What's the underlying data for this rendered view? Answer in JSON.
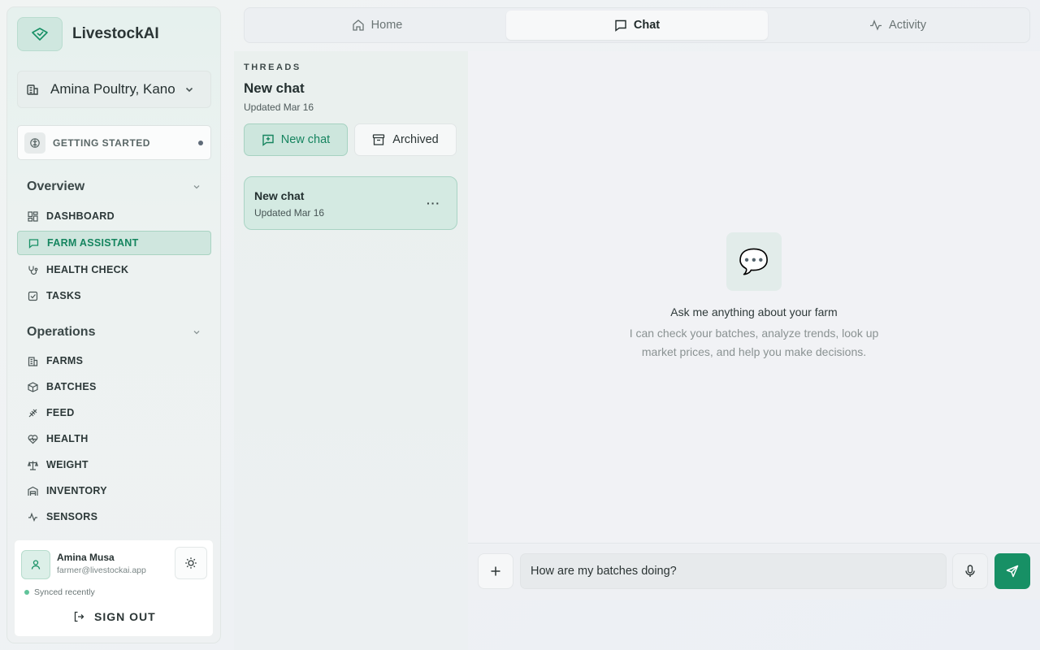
{
  "brand": {
    "name": "LivestockAI",
    "logo_icon": "leaf-icon"
  },
  "farm_selector": {
    "value": "Amina Poultry, Kano"
  },
  "getting_started": {
    "label": "GETTING STARTED"
  },
  "nav": {
    "overview": {
      "title": "Overview",
      "items": [
        {
          "label": "DASHBOARD",
          "icon": "dashboard-icon"
        },
        {
          "label": "FARM ASSISTANT",
          "icon": "chat-icon",
          "active": true
        },
        {
          "label": "HEALTH CHECK",
          "icon": "stethoscope-icon"
        },
        {
          "label": "TASKS",
          "icon": "checkbox-icon"
        }
      ]
    },
    "operations": {
      "title": "Operations",
      "items": [
        {
          "label": "FARMS",
          "icon": "building-icon"
        },
        {
          "label": "BATCHES",
          "icon": "box-icon"
        },
        {
          "label": "FEED",
          "icon": "wheat-icon"
        },
        {
          "label": "HEALTH",
          "icon": "heart-pulse-icon"
        },
        {
          "label": "WEIGHT",
          "icon": "scale-icon"
        },
        {
          "label": "INVENTORY",
          "icon": "warehouse-icon"
        },
        {
          "label": "SENSORS",
          "icon": "activity-icon"
        }
      ]
    }
  },
  "user": {
    "name": "Amina Musa",
    "email": "farmer@livestockai.app",
    "sync_status": "Synced recently",
    "sign_out_label": "SIGN OUT"
  },
  "tabs": [
    {
      "label": "Home",
      "icon": "home-icon"
    },
    {
      "label": "Chat",
      "icon": "chat-icon",
      "active": true
    },
    {
      "label": "Activity",
      "icon": "activity-icon"
    }
  ],
  "threads": {
    "section_label": "THREADS",
    "current_title": "New chat",
    "current_updated": "Updated Mar 16",
    "new_chat_label": "New chat",
    "archived_label": "Archived",
    "list": [
      {
        "title": "New chat",
        "updated": "Updated Mar 16",
        "more": "···"
      }
    ]
  },
  "chat": {
    "empty_icon": "💬",
    "empty_title": "Ask me anything about your farm",
    "empty_description": "I can check your batches, analyze trends, look up market prices, and help you make decisions.",
    "input_value": "How are my batches doing?"
  },
  "colors": {
    "accent": "#179065",
    "accent_light": "#cde6dd",
    "sync_dot": "#60c39a"
  }
}
